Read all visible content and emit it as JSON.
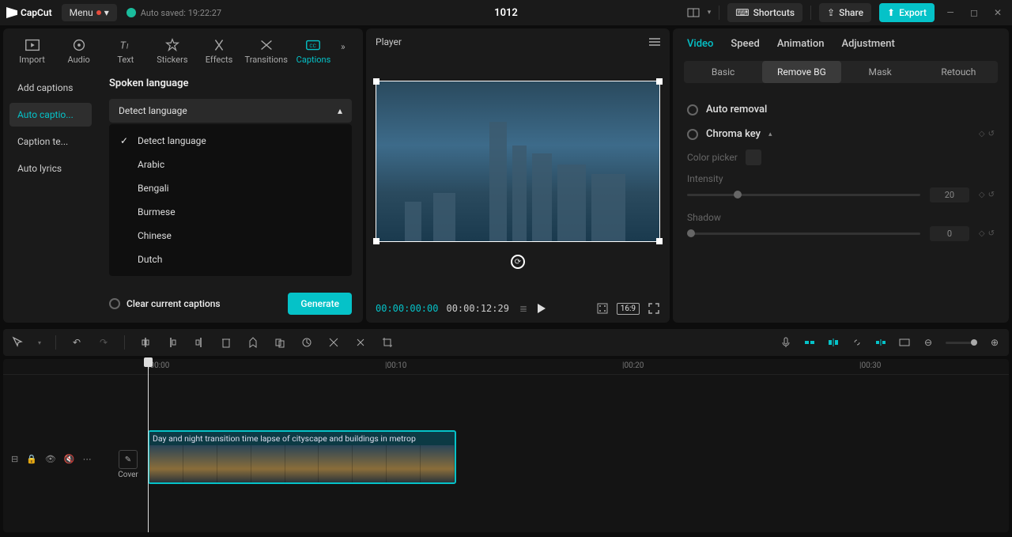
{
  "titlebar": {
    "app_name": "CapCut",
    "menu_label": "Menu",
    "autosave": "Auto saved: 19:22:27",
    "project_title": "1012",
    "shortcuts": "Shortcuts",
    "share": "Share",
    "export": "Export"
  },
  "media_tabs": {
    "import": "Import",
    "audio": "Audio",
    "text": "Text",
    "stickers": "Stickers",
    "effects": "Effects",
    "transitions": "Transitions",
    "captions": "Captions"
  },
  "caption_sidebar": {
    "add": "Add captions",
    "auto": "Auto captio...",
    "template": "Caption te...",
    "lyrics": "Auto lyrics"
  },
  "captions_panel": {
    "title": "Spoken language",
    "selected": "Detect language",
    "options": [
      "Detect language",
      "Arabic",
      "Bengali",
      "Burmese",
      "Chinese",
      "Dutch"
    ],
    "clear_label": "Clear current captions",
    "generate": "Generate"
  },
  "player": {
    "title": "Player",
    "timecode_current": "00:00:00:00",
    "timecode_total": "00:00:12:29",
    "ratio": "16:9"
  },
  "inspector": {
    "tabs": {
      "video": "Video",
      "speed": "Speed",
      "animation": "Animation",
      "adjustment": "Adjustment"
    },
    "subtabs": {
      "basic": "Basic",
      "removebg": "Remove BG",
      "mask": "Mask",
      "retouch": "Retouch"
    },
    "auto_removal": "Auto removal",
    "chroma_key": "Chroma key",
    "color_picker": "Color picker",
    "intensity": "Intensity",
    "intensity_val": "20",
    "shadow": "Shadow",
    "shadow_val": "0"
  },
  "timeline": {
    "marks": [
      "00:00",
      "00:10",
      "00:20",
      "00:30"
    ],
    "cover": "Cover",
    "clip_label": "Day and night transition time lapse of cityscape and buildings in metrop"
  }
}
